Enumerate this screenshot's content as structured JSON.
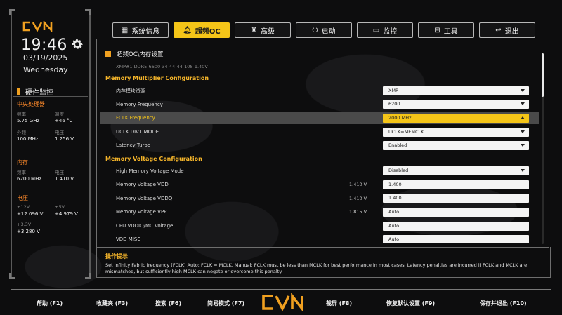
{
  "brand": {
    "logo_text": "CVN",
    "accent": "#f5c518",
    "orange": "#f0a020"
  },
  "clock": {
    "time": "19:46",
    "date": "03/19/2025",
    "weekday": "Wednesday"
  },
  "hardware_monitor": {
    "title": "硬件监控",
    "cpu": {
      "title": "中央处理器",
      "freq_label": "频率",
      "freq": "5.75 GHz",
      "temp_label": "温度",
      "temp": "+46 °C",
      "bclk_label": "外频",
      "bclk": "100 MHz",
      "volt_label": "电压",
      "volt": "1.256 V"
    },
    "memory": {
      "title": "内存",
      "freq_label": "频率",
      "freq": "6200 MHz",
      "volt_label": "电压",
      "volt": "1.410 V"
    },
    "voltage": {
      "title": "电压",
      "v12_label": "+12V",
      "v12": "+12.096 V",
      "v5_label": "+5V",
      "v5": "+4.979 V",
      "v33_label": "+3.3V",
      "v33": "+3.280 V"
    }
  },
  "tabs": [
    {
      "label": "系统信息",
      "icon": "grid-icon"
    },
    {
      "label": "超频OC",
      "icon": "bell-icon",
      "active": true
    },
    {
      "label": "高级",
      "icon": "castle-icon"
    },
    {
      "label": "启动",
      "icon": "power-icon"
    },
    {
      "label": "监控",
      "icon": "monitor-icon"
    },
    {
      "label": "工具",
      "icon": "toolbox-icon"
    },
    {
      "label": "退出",
      "icon": "return-icon"
    }
  ],
  "breadcrumb": "超频OC\\内存设置",
  "xmp_info": "XMP#1   DDR5-6600 34-44-44-108-1.40V",
  "groups": {
    "multiplier": "Memory Multiplier Configuration",
    "voltage": "Memory Voltage Configuration"
  },
  "settings": [
    {
      "label": "内存模块资源",
      "value": "XMP",
      "type": "dropdown"
    },
    {
      "label": "Memory Frequency",
      "value": "6200",
      "type": "dropdown"
    },
    {
      "label": "FCLK Frequency",
      "value": "2000 MHz",
      "type": "dropdown",
      "selected": true
    },
    {
      "label": "UCLK DIV1 MODE",
      "value": "UCLK=MEMCLK",
      "type": "dropdown"
    },
    {
      "label": "Latency Turbo",
      "value": "Enabled",
      "type": "dropdown"
    },
    {
      "label": "High Memory Voltage Mode",
      "value": "Disabled",
      "type": "dropdown"
    },
    {
      "label": "Memory Voltage VDD",
      "current": "1.410 V",
      "value": "1.400",
      "type": "input"
    },
    {
      "label": "Memory Voltage VDDQ",
      "current": "1.410 V",
      "value": "1.400",
      "type": "input"
    },
    {
      "label": "Memory Voltage VPP",
      "current": "1.815 V",
      "value": "Auto",
      "type": "input"
    },
    {
      "label": "CPU VDDIO/MC Voltage",
      "value": "Auto",
      "type": "input"
    },
    {
      "label": "VDD MISC",
      "value": "Auto",
      "type": "input"
    }
  ],
  "help": {
    "title": "操作提示",
    "text": "Set Infinity Fabric frequency (FCLK) Auto: FCLK = MCLK. Manual: FCLK must be less than MCLK for best performance in most cases. Latency penalties are incurred if FCLK and MCLK are mismatched, but sufficiently high MCLK can negate or overcome this penalty."
  },
  "function_keys": [
    {
      "label": "帮助 (F1)"
    },
    {
      "label": "收藏夹 (F3)"
    },
    {
      "label": "搜索 (F6)"
    },
    {
      "label": "简易模式 (F7)"
    },
    {
      "label": "截屏 (F8)"
    },
    {
      "label": "恢复默认设置 (F9)"
    },
    {
      "label": "保存并退出 (F10)"
    }
  ]
}
